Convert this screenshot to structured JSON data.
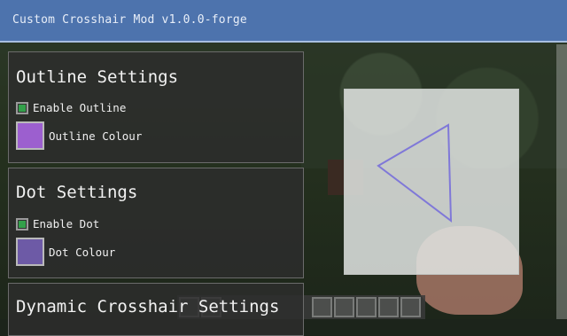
{
  "window": {
    "title": "Custom Crosshair Mod v1.0.0-forge"
  },
  "outline_settings": {
    "heading": "Outline Settings",
    "enable_label": "Enable Outline",
    "enable_checked": true,
    "colour_label": "Outline Colour",
    "colour_value": "#9c5fcf"
  },
  "dot_settings": {
    "heading": "Dot Settings",
    "enable_label": "Enable Dot",
    "enable_checked": true,
    "colour_label": "Dot Colour",
    "colour_value": "#6d5aa6"
  },
  "dynamic_settings": {
    "heading": "Dynamic Crosshair Settings"
  },
  "colors": {
    "titlebar": "#4d73ad",
    "checkbox_checked": "#33a04a",
    "crosshair_stroke": "#7f78d8"
  },
  "preview": {
    "icon": "triangle-crosshair-icon"
  }
}
